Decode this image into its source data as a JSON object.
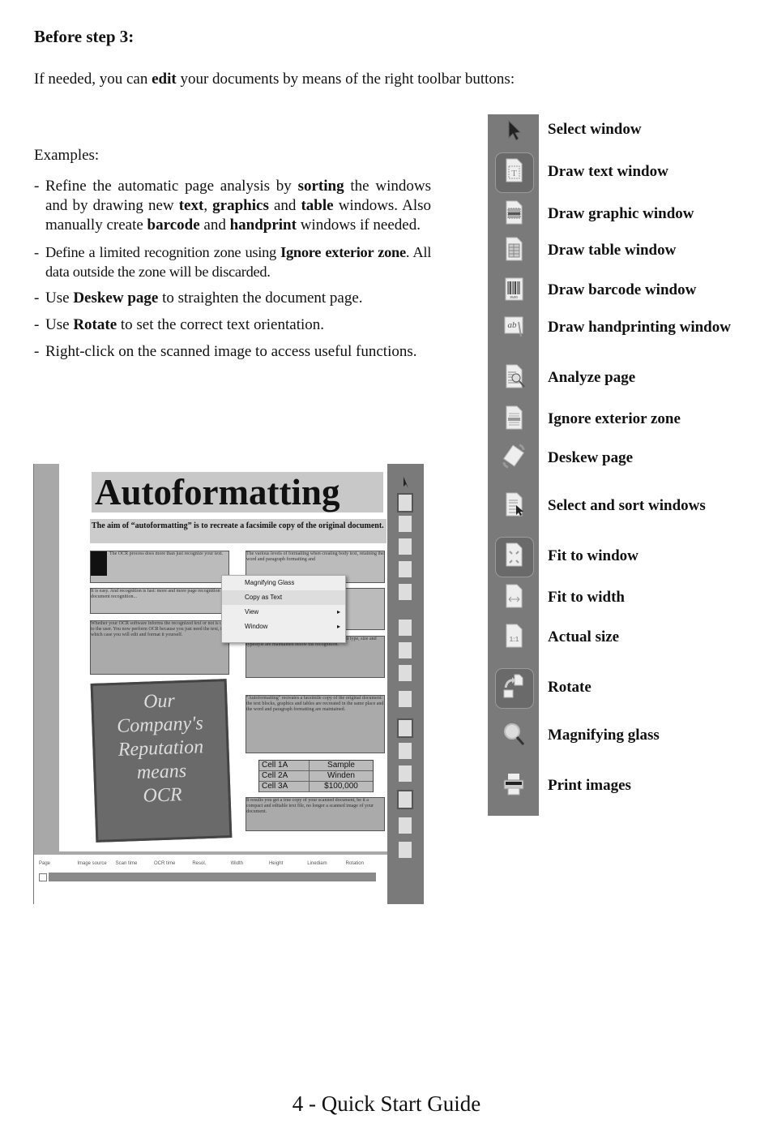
{
  "heading": "Before step 3:",
  "intro": {
    "before": "If needed, you can ",
    "bold": "edit",
    "after": " your documents by means of the right toolbar buttons:"
  },
  "examples_label": "Examples:",
  "bullets": [
    {
      "parts": [
        {
          "t": "Refine the automatic page analysis by "
        },
        {
          "t": "sorting",
          "b": true
        },
        {
          "t": " the windows and by drawing new "
        },
        {
          "t": "text",
          "b": true
        },
        {
          "t": ", "
        },
        {
          "t": "graphics",
          "b": true
        },
        {
          "t": " and "
        },
        {
          "t": "table",
          "b": true
        },
        {
          "t": " windows. Also manually create "
        },
        {
          "t": "barcode",
          "b": true
        },
        {
          "t": " and "
        },
        {
          "t": "handprint",
          "b": true
        },
        {
          "t": " windows if needed."
        }
      ]
    },
    {
      "parts": [
        {
          "t": "Define a limited recognition zone using "
        },
        {
          "t": "Ignore exterior zone",
          "b": true
        },
        {
          "t": ". All data outside the zone will be discarded."
        }
      ]
    },
    {
      "parts": [
        {
          "t": "Use "
        },
        {
          "t": "Deskew page",
          "b": true
        },
        {
          "t": " to straighten the document page."
        }
      ]
    },
    {
      "parts": [
        {
          "t": "Use "
        },
        {
          "t": "Rotate",
          "b": true
        },
        {
          "t": " to set the correct text orientation."
        }
      ]
    },
    {
      "parts": [
        {
          "t": "Right-click on the scanned image to access useful functions."
        }
      ]
    }
  ],
  "toolbar": [
    {
      "icon": "arrow-pointer-icon",
      "label": "Select window"
    },
    {
      "icon": "text-window-icon",
      "label": "Draw text window",
      "active": true
    },
    {
      "icon": "graphic-window-icon",
      "label": "Draw graphic window"
    },
    {
      "icon": "table-window-icon",
      "label": "Draw table window"
    },
    {
      "icon": "barcode-window-icon",
      "label": "Draw barcode window"
    },
    {
      "icon": "handprint-window-icon",
      "label": "Draw handprinting window"
    },
    {
      "icon": "analyze-page-icon",
      "label": "Analyze page"
    },
    {
      "icon": "ignore-exterior-zone-icon",
      "label": "Ignore exterior zone"
    },
    {
      "icon": "deskew-page-icon",
      "label": "Deskew page"
    },
    {
      "icon": "select-sort-windows-icon",
      "label": "Select and sort windows"
    },
    {
      "icon": "fit-to-window-icon",
      "label": "Fit to window",
      "active": true
    },
    {
      "icon": "fit-to-width-icon",
      "label": "Fit to width"
    },
    {
      "icon": "actual-size-icon",
      "label": "Actual size",
      "glyph": "1:1"
    },
    {
      "icon": "rotate-icon",
      "label": "Rotate",
      "active": true
    },
    {
      "icon": "magnifying-glass-icon",
      "label": "Magnifying glass"
    },
    {
      "icon": "printer-icon",
      "label": "Print images"
    }
  ],
  "screenshot": {
    "title": "Autoformatting",
    "subtitle": "The aim of “autoformatting” is to recreate a facsimile copy of the original document.",
    "poster_text": [
      "Our",
      "Company's",
      "Reputation",
      "means",
      "OCR"
    ],
    "context_menu": [
      {
        "label": "Magnifying Glass"
      },
      {
        "label": "Copy as Text",
        "highlighted": true
      },
      {
        "label": "View",
        "submenu": true
      },
      {
        "label": "Window",
        "submenu": true
      }
    ],
    "submenu_arrow": "▸",
    "table": {
      "header": [
        "Cell 1A",
        "Sample"
      ],
      "rows": [
        [
          "Cell 2A",
          "Winden"
        ],
        [
          "Cell 3A",
          "$100,000"
        ]
      ]
    },
    "grid_headers": [
      "Page",
      "Image source",
      "Scan time",
      "OCR time",
      "Resol.",
      "Width",
      "Height",
      "Linediam",
      "Rotation"
    ]
  },
  "footer": "4 - Quick Start Guide"
}
